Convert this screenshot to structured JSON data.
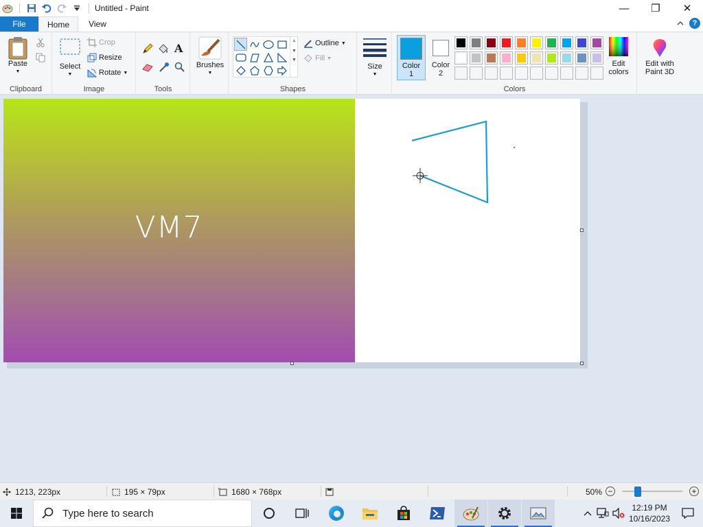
{
  "window": {
    "title": "Untitled - Paint",
    "controls": {
      "minimize": "—",
      "maximize": "❐",
      "close": "✕"
    }
  },
  "tabs": {
    "file": "File",
    "home": "Home",
    "view": "View",
    "help": "?"
  },
  "ribbon": {
    "clipboard": {
      "label": "Clipboard",
      "paste": "Paste"
    },
    "image": {
      "label": "Image",
      "select": "Select",
      "crop": "Crop",
      "resize": "Resize",
      "rotate": "Rotate"
    },
    "tools": {
      "label": "Tools"
    },
    "brushes": {
      "label": "Brushes"
    },
    "shapes": {
      "label": "Shapes",
      "outline": "Outline",
      "fill": "Fill"
    },
    "size": {
      "label": "Size"
    },
    "colors": {
      "label": "Colors",
      "color1": "Color\n1",
      "color1_line1": "Color",
      "color1_line2": "1",
      "color2_line1": "Color",
      "color2_line2": "2",
      "edit_line1": "Edit",
      "edit_line2": "colors",
      "color1_value": "#0c9fe0",
      "color2_value": "#ffffff",
      "palette": [
        "#000000",
        "#7f7f7f",
        "#880015",
        "#ed1c24",
        "#ff7f27",
        "#fff200",
        "#22b14c",
        "#00a2e8",
        "#3f48cc",
        "#a349a4",
        "#ffffff",
        "#c3c3c3",
        "#b97a57",
        "#ffaec9",
        "#ffc90e",
        "#efe4b0",
        "#b5e61d",
        "#99d9ea",
        "#7092be",
        "#c8bfe7"
      ]
    },
    "paint3d": {
      "line1": "Edit with",
      "line2": "Paint 3D"
    }
  },
  "canvas": {
    "text": "VM7",
    "stroke_color": "#1e9bd7"
  },
  "status": {
    "cursor_pos": "1213, 223px",
    "selection_size": "195 × 79px",
    "image_size": "1680 × 768px",
    "zoom": "50%"
  },
  "taskbar": {
    "search_placeholder": "Type here to search",
    "time": "12:19 PM",
    "date": "10/16/2023"
  }
}
